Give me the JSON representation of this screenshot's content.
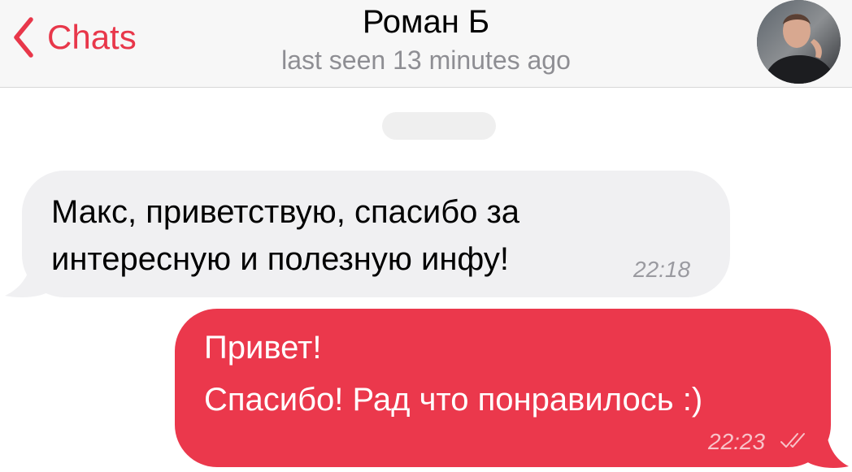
{
  "header": {
    "back_label": "Chats",
    "contact_name": "Роман Б",
    "status": "last seen 13 minutes ago",
    "accent_color": "#e8374a"
  },
  "messages": [
    {
      "direction": "incoming",
      "text": "Макс, приветствую, спасибо за интересную и полезную инфу!",
      "time": "22:18"
    },
    {
      "direction": "outgoing",
      "lines": [
        "Привет!",
        "Спасибо! Рад что понравилось :)"
      ],
      "time": "22:23",
      "status_icon": "double-check-icon"
    }
  ],
  "colors": {
    "incoming_bubble": "#f0f0f2",
    "outgoing_bubble": "#eb384c"
  }
}
